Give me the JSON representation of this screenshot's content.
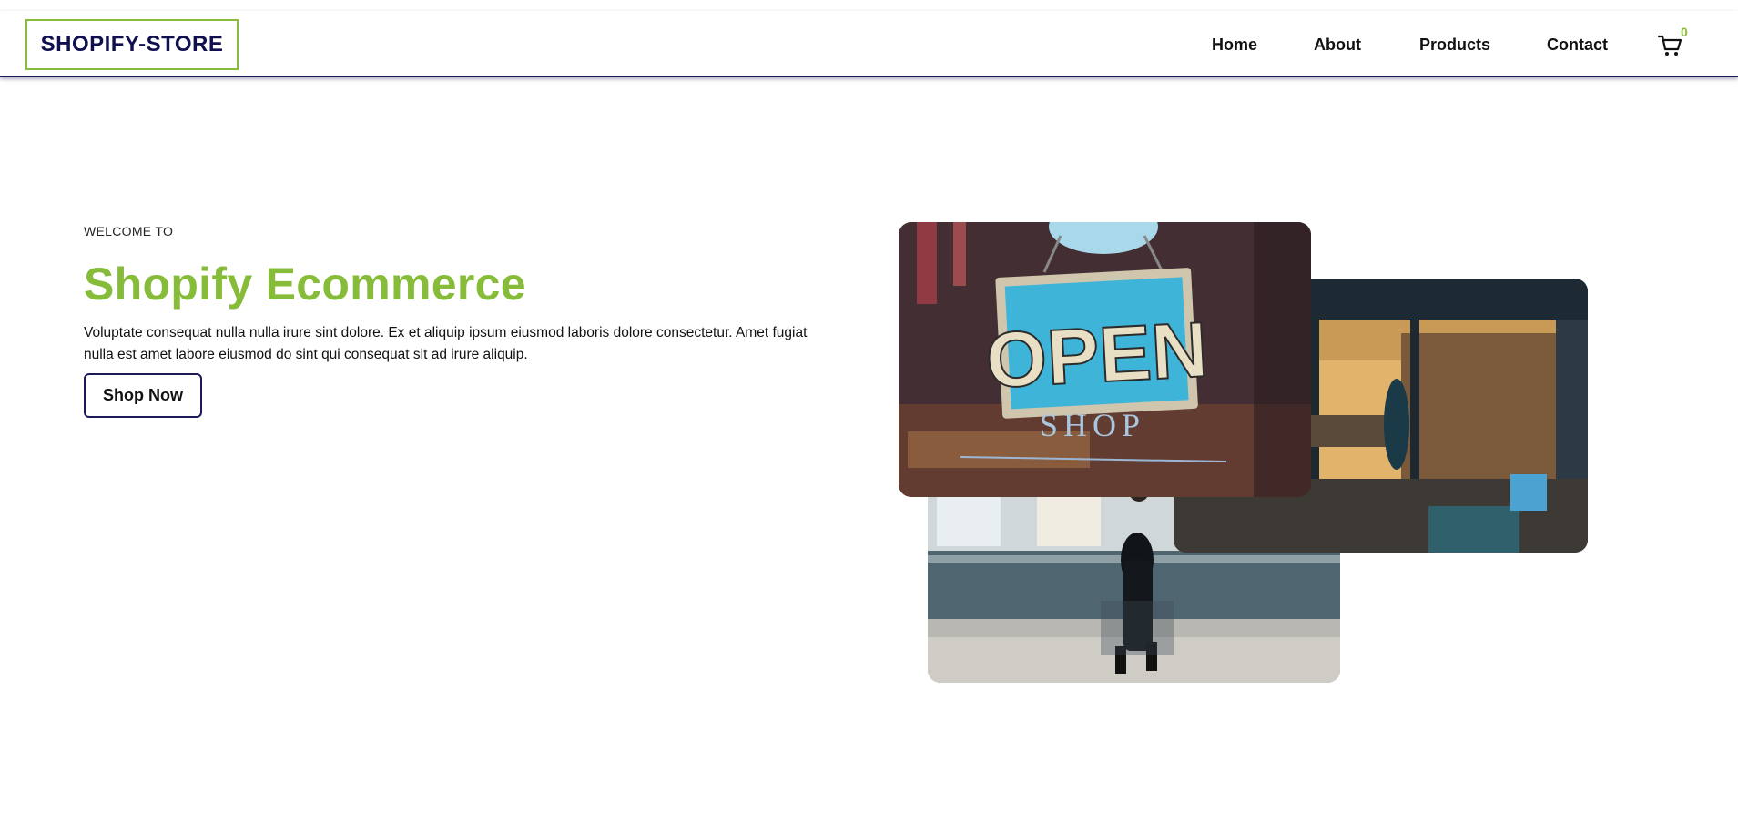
{
  "header": {
    "logo": "SHOPIFY-STORE",
    "nav": [
      "Home",
      "About",
      "Products",
      "Contact"
    ],
    "cart": {
      "icon": "cart-icon",
      "count": "0"
    }
  },
  "hero": {
    "welcome": "WELCOME TO",
    "title": "Shopify Ecommerce",
    "text": "Voluptate consequat nulla nulla irure sint dolore. Ex et aliquip ipsum eiusmod laboris dolore consectetur. Amet fugiat nulla est amet labore eiusmod do sint qui consequat sit ad irure aliquip.",
    "button": "Shop Now"
  },
  "images": {
    "open_sign": {
      "sign_text": "OPEN",
      "shop_text": "SHOP"
    }
  },
  "colors": {
    "brand_navy": "#1b1a57",
    "accent_green": "#86bc3a"
  }
}
